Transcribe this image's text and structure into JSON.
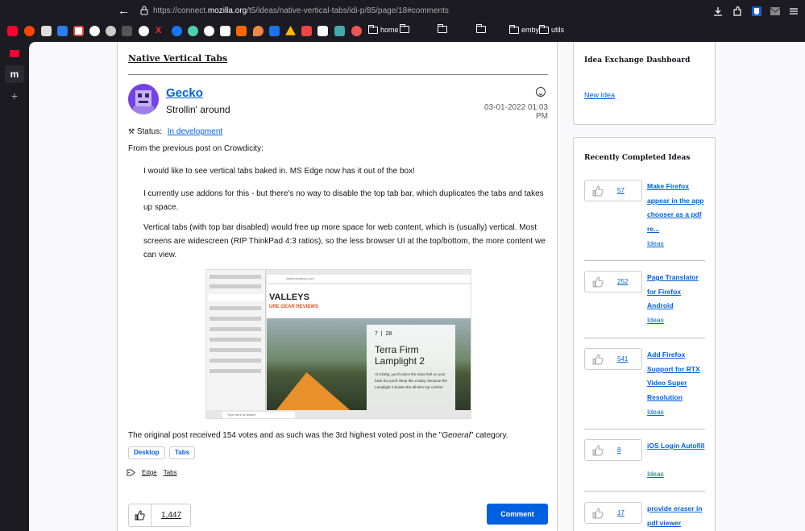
{
  "browser": {
    "url_prefix": "https://connect.",
    "url_domain": "mozilla.org",
    "url_path": "/t5/ideas/native-vertical-tabs/idi-p/85/page/18#comments",
    "bookmark_folders": [
      "home",
      "",
      "",
      "",
      "emby",
      "utils"
    ]
  },
  "sidebar": {
    "logo_letter": "m",
    "add_label": "+"
  },
  "post": {
    "title": "Native Vertical Tabs",
    "author": "Gecko",
    "author_subtitle": "Strollin' around",
    "date": "03-01-2022 01:03 PM",
    "status_label": "Status:",
    "status_value": "In development",
    "intro": "From the previous post on Crowdicity:",
    "quote_1": "I would like to see vertical tabs baked in. MS Edge now has it out of the box!",
    "quote_2": "I currently use addons for this - but there's no way to disable the top tab bar, which duplicates the tabs and takes up space.",
    "quote_3": "Vertical tabs (with top bar disabled) would free up more space for web content, which is (usually) vertical. Most screens are widescreen (RIP ThinkPad 4:3 ratios), so the less browser UI at the top/bottom, the more content we can view.",
    "outro_start": "The original post received 154 votes and as such was the 3rd highest voted post in the \"",
    "outro_em": "General",
    "outro_end": "\" category.",
    "chips": [
      "Desktop",
      "Tabs"
    ],
    "tags": [
      "Edge",
      "Tabs"
    ],
    "votes": "1,447",
    "comment_label": "Comment"
  },
  "screenshot": {
    "url": "splitandvalleys.com",
    "site_name": "VALLEYS",
    "site_tagline": "URE GEAR REVIEWS",
    "card_nums": [
      "7",
      "28"
    ],
    "card_title": "Terra Firm Lamplight 2",
    "card_text": "At 2150g, you'll notice the extra heft on your back but you'll sleep like a baby, because the Lamplight 2 boasts the all-time top comfort",
    "taskbar_search": "Type here to search"
  },
  "dashboard": {
    "title": "Idea Exchange Dashboard",
    "link": "New Idea"
  },
  "completed": {
    "title": "Recently Completed Ideas",
    "items": [
      {
        "votes": "57",
        "title": "Make Firefox appear in the app chooser as a pdf re...",
        "category": "Ideas"
      },
      {
        "votes": "252",
        "title": "Page Translator for Firefox Android",
        "category": "Ideas"
      },
      {
        "votes": "541",
        "title": "Add Firefox Support for RTX Video Super Resolution",
        "category": "Ideas"
      },
      {
        "votes": "8",
        "title": "iOS Login Autofill",
        "category": "Ideas"
      },
      {
        "votes": "17",
        "title": "provide eraser in pdf viewer",
        "category": ""
      }
    ]
  }
}
